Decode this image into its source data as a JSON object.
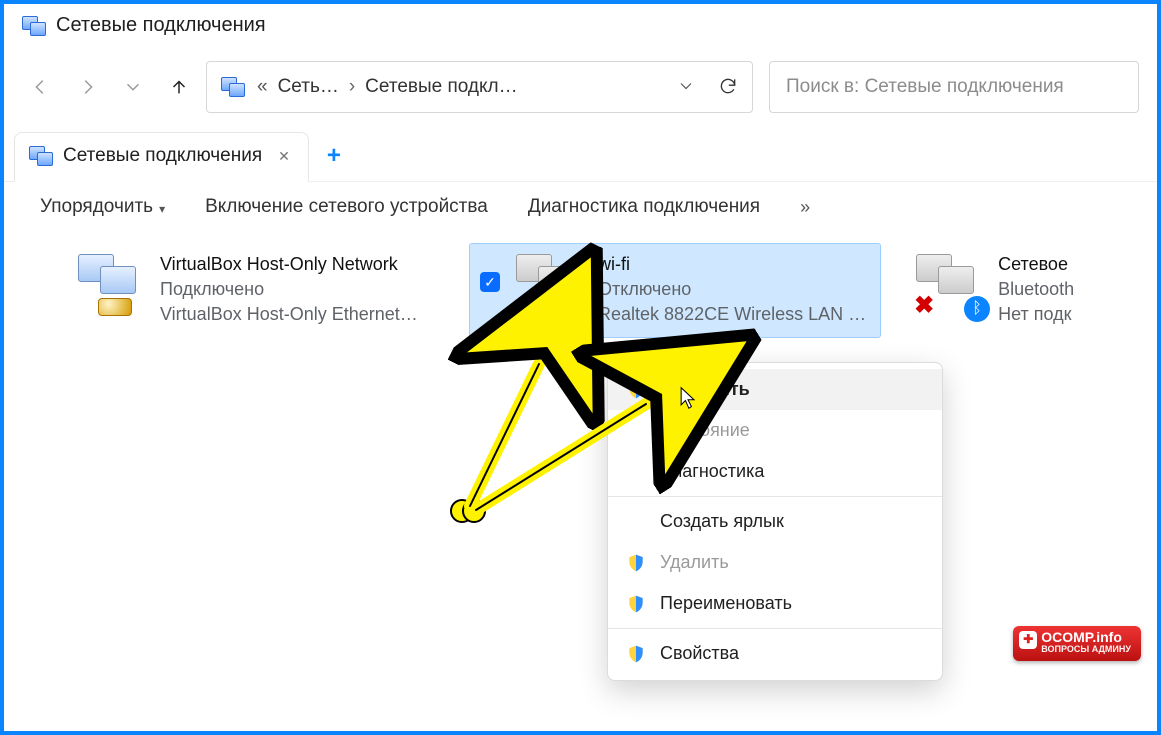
{
  "window": {
    "title": "Сетевые подключения"
  },
  "address": {
    "segment1": "Сеть…",
    "segment2": "Сетевые подкл…"
  },
  "search": {
    "placeholder": "Поиск в: Сетевые подключения"
  },
  "tab": {
    "label": "Сетевые подключения"
  },
  "toolbar": {
    "sort": "Упорядочить",
    "enable": "Включение сетевого устройства",
    "diag": "Диагностика подключения",
    "more": "»"
  },
  "connections": [
    {
      "name": "VirtualBox Host-Only Network",
      "status": "Подключено",
      "driver": "VirtualBox Host-Only Ethernet…",
      "selected": false,
      "kind": "ethernet"
    },
    {
      "name": "wi-fi",
      "status": "Отключено",
      "driver": "Realtek 8822CE Wireless LAN …",
      "selected": true,
      "kind": "wifi"
    },
    {
      "name": "Сетевое",
      "status": "Bluetooth",
      "driver": "Нет подк",
      "selected": false,
      "kind": "bluetooth"
    }
  ],
  "context_menu": {
    "items": [
      {
        "label": "Включить",
        "shield": true,
        "bold": true,
        "hover": true
      },
      {
        "label": "Состояние",
        "shield": false,
        "disabled": true
      },
      {
        "label": "Диагностика",
        "shield": false
      },
      {
        "sep": true
      },
      {
        "label": "Создать ярлык",
        "shield": false
      },
      {
        "label": "Удалить",
        "shield": true,
        "disabled": true
      },
      {
        "label": "Переименовать",
        "shield": true
      },
      {
        "sep": true
      },
      {
        "label": "Свойства",
        "shield": true
      }
    ]
  },
  "watermark": {
    "main": "OCOMP.info",
    "sub": "ВОПРОСЫ АДМИНУ"
  }
}
